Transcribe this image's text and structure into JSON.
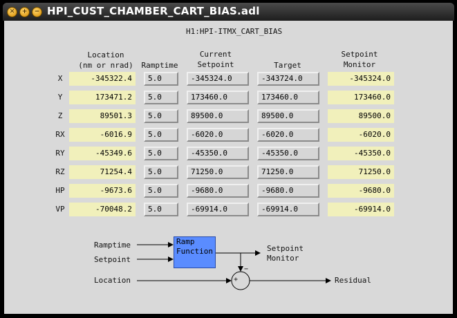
{
  "window": {
    "title": "HPI_CUST_CHAMBER_CART_BIAS.adl"
  },
  "page": {
    "pv_title": "H1:HPI-ITMX_CART_BIAS"
  },
  "headers": {
    "location_1": "Location",
    "location_2": "(nm or nrad)",
    "ramptime": "Ramptime",
    "current_1": "Current",
    "current_2": "Setpoint",
    "target": "Target",
    "monitor_1": "Setpoint",
    "monitor_2": "Monitor"
  },
  "rows": [
    {
      "label": "X",
      "location": "-345322.4",
      "ramptime": "5.0",
      "current": "-345324.0",
      "target": "-343724.0",
      "monitor": "-345324.0"
    },
    {
      "label": "Y",
      "location": "173471.2",
      "ramptime": "5.0",
      "current": "173460.0",
      "target": "173460.0",
      "monitor": "173460.0"
    },
    {
      "label": "Z",
      "location": "89501.3",
      "ramptime": "5.0",
      "current": "89500.0",
      "target": "89500.0",
      "monitor": "89500.0"
    },
    {
      "label": "RX",
      "location": "-6016.9",
      "ramptime": "5.0",
      "current": "-6020.0",
      "target": "-6020.0",
      "monitor": "-6020.0"
    },
    {
      "label": "RY",
      "location": "-45349.6",
      "ramptime": "5.0",
      "current": "-45350.0",
      "target": "-45350.0",
      "monitor": "-45350.0"
    },
    {
      "label": "RZ",
      "location": "71254.4",
      "ramptime": "5.0",
      "current": "71250.0",
      "target": "71250.0",
      "monitor": "71250.0"
    },
    {
      "label": "HP",
      "location": "-9673.6",
      "ramptime": "5.0",
      "current": "-9680.0",
      "target": "-9680.0",
      "monitor": "-9680.0"
    },
    {
      "label": "VP",
      "location": "-70048.2",
      "ramptime": "5.0",
      "current": "-69914.0",
      "target": "-69914.0",
      "monitor": "-69914.0"
    }
  ],
  "diagram": {
    "ramptime": "Ramptime",
    "setpoint": "Setpoint",
    "location": "Location",
    "ramp_1": "Ramp",
    "ramp_2": "Function",
    "monitor_1": "Setpoint",
    "monitor_2": "Monitor",
    "residual": "Residual",
    "plus": "+",
    "minus": "−"
  },
  "colors": {
    "monitor_bg": "#f1f0bb",
    "entry_bg": "#d6d6d6",
    "ramp_box": "#5a8cff",
    "panel_bg": "#d9d9d9"
  }
}
